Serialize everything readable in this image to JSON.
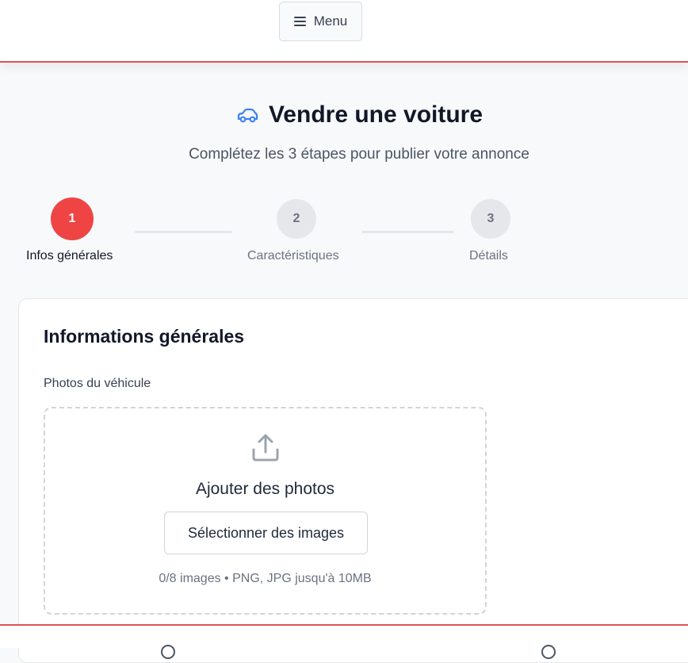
{
  "header": {
    "menu_label": "Menu",
    "menu_icon": "hamburger-icon"
  },
  "page": {
    "title": "Vendre une voiture",
    "title_icon": "car-icon",
    "subtitle": "Complétez les 3 étapes pour publier votre annonce"
  },
  "steps": [
    {
      "number": "1",
      "label": "Infos générales",
      "state": "active"
    },
    {
      "number": "2",
      "label": "Caractéristiques",
      "state": "inactive"
    },
    {
      "number": "3",
      "label": "Détails",
      "state": "inactive"
    }
  ],
  "form": {
    "section_title": "Informations générales",
    "photos_label": "Photos du véhicule",
    "upload": {
      "icon": "upload-icon",
      "title": "Ajouter des photos",
      "button_label": "Sélectionner des images",
      "hint": "0/8 images • PNG, JPG jusqu'à 10MB"
    }
  },
  "colors": {
    "accent": "#ef4444",
    "accent_line": "#e05454",
    "icon_blue": "#3b82f6",
    "inactive": "#e5e7eb"
  }
}
